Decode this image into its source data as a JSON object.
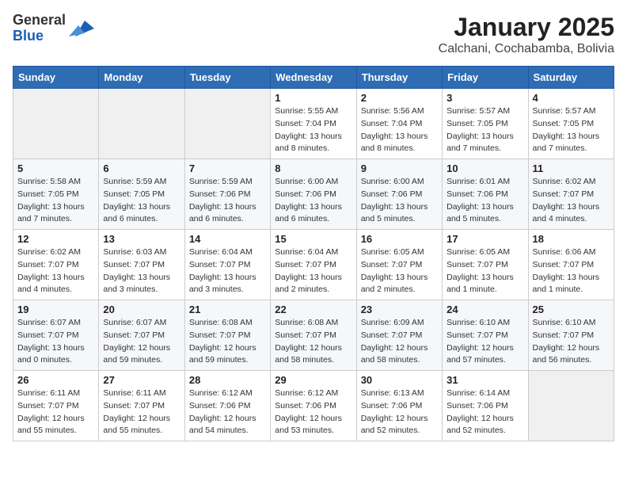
{
  "header": {
    "logo_general": "General",
    "logo_blue": "Blue",
    "month_year": "January 2025",
    "location": "Calchani, Cochabamba, Bolivia"
  },
  "weekdays": [
    "Sunday",
    "Monday",
    "Tuesday",
    "Wednesday",
    "Thursday",
    "Friday",
    "Saturday"
  ],
  "weeks": [
    [
      {
        "day": "",
        "info": ""
      },
      {
        "day": "",
        "info": ""
      },
      {
        "day": "",
        "info": ""
      },
      {
        "day": "1",
        "info": "Sunrise: 5:55 AM\nSunset: 7:04 PM\nDaylight: 13 hours and 8 minutes."
      },
      {
        "day": "2",
        "info": "Sunrise: 5:56 AM\nSunset: 7:04 PM\nDaylight: 13 hours and 8 minutes."
      },
      {
        "day": "3",
        "info": "Sunrise: 5:57 AM\nSunset: 7:05 PM\nDaylight: 13 hours and 7 minutes."
      },
      {
        "day": "4",
        "info": "Sunrise: 5:57 AM\nSunset: 7:05 PM\nDaylight: 13 hours and 7 minutes."
      }
    ],
    [
      {
        "day": "5",
        "info": "Sunrise: 5:58 AM\nSunset: 7:05 PM\nDaylight: 13 hours and 7 minutes."
      },
      {
        "day": "6",
        "info": "Sunrise: 5:59 AM\nSunset: 7:05 PM\nDaylight: 13 hours and 6 minutes."
      },
      {
        "day": "7",
        "info": "Sunrise: 5:59 AM\nSunset: 7:06 PM\nDaylight: 13 hours and 6 minutes."
      },
      {
        "day": "8",
        "info": "Sunrise: 6:00 AM\nSunset: 7:06 PM\nDaylight: 13 hours and 6 minutes."
      },
      {
        "day": "9",
        "info": "Sunrise: 6:00 AM\nSunset: 7:06 PM\nDaylight: 13 hours and 5 minutes."
      },
      {
        "day": "10",
        "info": "Sunrise: 6:01 AM\nSunset: 7:06 PM\nDaylight: 13 hours and 5 minutes."
      },
      {
        "day": "11",
        "info": "Sunrise: 6:02 AM\nSunset: 7:07 PM\nDaylight: 13 hours and 4 minutes."
      }
    ],
    [
      {
        "day": "12",
        "info": "Sunrise: 6:02 AM\nSunset: 7:07 PM\nDaylight: 13 hours and 4 minutes."
      },
      {
        "day": "13",
        "info": "Sunrise: 6:03 AM\nSunset: 7:07 PM\nDaylight: 13 hours and 3 minutes."
      },
      {
        "day": "14",
        "info": "Sunrise: 6:04 AM\nSunset: 7:07 PM\nDaylight: 13 hours and 3 minutes."
      },
      {
        "day": "15",
        "info": "Sunrise: 6:04 AM\nSunset: 7:07 PM\nDaylight: 13 hours and 2 minutes."
      },
      {
        "day": "16",
        "info": "Sunrise: 6:05 AM\nSunset: 7:07 PM\nDaylight: 13 hours and 2 minutes."
      },
      {
        "day": "17",
        "info": "Sunrise: 6:05 AM\nSunset: 7:07 PM\nDaylight: 13 hours and 1 minute."
      },
      {
        "day": "18",
        "info": "Sunrise: 6:06 AM\nSunset: 7:07 PM\nDaylight: 13 hours and 1 minute."
      }
    ],
    [
      {
        "day": "19",
        "info": "Sunrise: 6:07 AM\nSunset: 7:07 PM\nDaylight: 13 hours and 0 minutes."
      },
      {
        "day": "20",
        "info": "Sunrise: 6:07 AM\nSunset: 7:07 PM\nDaylight: 12 hours and 59 minutes."
      },
      {
        "day": "21",
        "info": "Sunrise: 6:08 AM\nSunset: 7:07 PM\nDaylight: 12 hours and 59 minutes."
      },
      {
        "day": "22",
        "info": "Sunrise: 6:08 AM\nSunset: 7:07 PM\nDaylight: 12 hours and 58 minutes."
      },
      {
        "day": "23",
        "info": "Sunrise: 6:09 AM\nSunset: 7:07 PM\nDaylight: 12 hours and 58 minutes."
      },
      {
        "day": "24",
        "info": "Sunrise: 6:10 AM\nSunset: 7:07 PM\nDaylight: 12 hours and 57 minutes."
      },
      {
        "day": "25",
        "info": "Sunrise: 6:10 AM\nSunset: 7:07 PM\nDaylight: 12 hours and 56 minutes."
      }
    ],
    [
      {
        "day": "26",
        "info": "Sunrise: 6:11 AM\nSunset: 7:07 PM\nDaylight: 12 hours and 55 minutes."
      },
      {
        "day": "27",
        "info": "Sunrise: 6:11 AM\nSunset: 7:07 PM\nDaylight: 12 hours and 55 minutes."
      },
      {
        "day": "28",
        "info": "Sunrise: 6:12 AM\nSunset: 7:06 PM\nDaylight: 12 hours and 54 minutes."
      },
      {
        "day": "29",
        "info": "Sunrise: 6:12 AM\nSunset: 7:06 PM\nDaylight: 12 hours and 53 minutes."
      },
      {
        "day": "30",
        "info": "Sunrise: 6:13 AM\nSunset: 7:06 PM\nDaylight: 12 hours and 52 minutes."
      },
      {
        "day": "31",
        "info": "Sunrise: 6:14 AM\nSunset: 7:06 PM\nDaylight: 12 hours and 52 minutes."
      },
      {
        "day": "",
        "info": ""
      }
    ]
  ]
}
